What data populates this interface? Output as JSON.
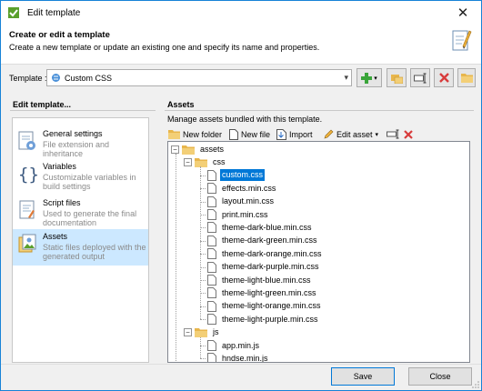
{
  "window": {
    "title": "Edit template"
  },
  "header": {
    "title": "Create or edit a template",
    "subtitle": "Create a new template or update an existing one and specify its name and properties."
  },
  "template": {
    "label": "Template :",
    "selected": "Custom CSS"
  },
  "left": {
    "title": "Edit template...",
    "items": [
      {
        "title": "General settings",
        "desc": "File extension and inheritance",
        "icon": "settings-icon"
      },
      {
        "title": "Variables",
        "desc": "Customizable variables in build settings",
        "icon": "braces-icon"
      },
      {
        "title": "Script files",
        "desc": "Used to generate the final documentation",
        "icon": "script-icon"
      },
      {
        "title": "Assets",
        "desc": "Static files deployed with the generated output",
        "icon": "assets-icon",
        "selected": true
      }
    ]
  },
  "assets": {
    "title": "Assets",
    "description": "Manage assets bundled with this template.",
    "toolbar": {
      "new_folder": "New folder",
      "new_file": "New file",
      "import": "Import",
      "edit_asset": "Edit asset"
    },
    "tree": {
      "root": "assets",
      "css_folder": "css",
      "css_files": [
        "custom.css",
        "effects.min.css",
        "layout.min.css",
        "print.min.css",
        "theme-dark-blue.min.css",
        "theme-dark-green.min.css",
        "theme-dark-orange.min.css",
        "theme-dark-purple.min.css",
        "theme-light-blue.min.css",
        "theme-light-green.min.css",
        "theme-light-orange.min.css",
        "theme-light-purple.min.css"
      ],
      "selected_file": "custom.css",
      "js_folder": "js",
      "js_files": [
        "app.min.js",
        "hndse.min.js"
      ]
    }
  },
  "footer": {
    "save": "Save",
    "close": "Close"
  },
  "colors": {
    "selection": "#0078d7",
    "nav_selected": "#cce8ff",
    "folder": "#e8b64c",
    "accent_green": "#3aa53a",
    "accent_red": "#d83b3b"
  }
}
